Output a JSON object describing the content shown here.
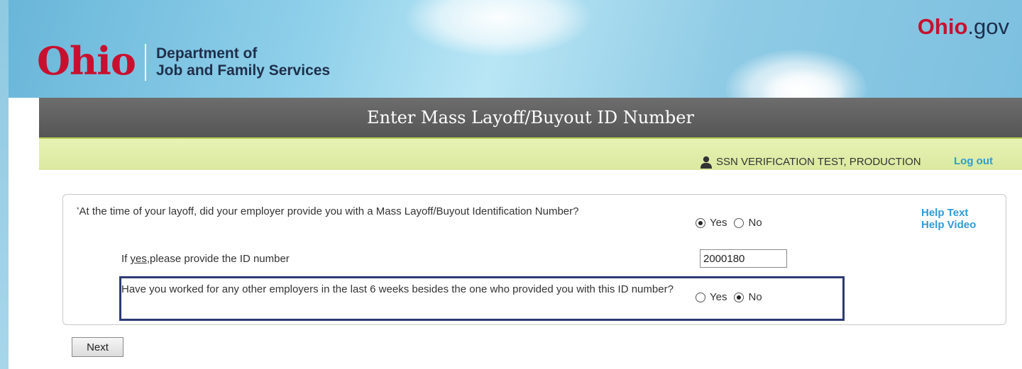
{
  "header": {
    "logo_word": "Ohio",
    "department_line1": "Department of",
    "department_line2": "Job and Family Services",
    "ohio_gov_part1": "Ohio",
    "ohio_gov_part2": ".gov"
  },
  "page_title": "Enter Mass Layoff/Buyout ID Number",
  "user_bar": {
    "user_icon": "user-icon",
    "user_name": "SSN VERIFICATION TEST, PRODUCTION",
    "logout_label": "Log out"
  },
  "form": {
    "q1": {
      "required_mark": "*",
      "text": "At the time of your layoff, did your employer provide you with a Mass Layoff/Buyout Identification Number?",
      "options": [
        "Yes",
        "No"
      ],
      "selected": "Yes"
    },
    "q2": {
      "prefix": "If ",
      "underlined": "yes",
      "suffix": ",please provide the ID number",
      "value": "2000180"
    },
    "q3": {
      "text": "Have you worked for any other employers in the last 6 weeks besides the one who provided you with this ID number?",
      "options": [
        "Yes",
        "No"
      ],
      "selected": "No"
    },
    "help_text_label": "Help Text",
    "help_video_label": "Help Video"
  },
  "next_label": "Next",
  "colors": {
    "ohio_red": "#c8102e",
    "link_blue": "#2f9bd6",
    "highlight_navy": "#2d3b73",
    "title_bar_gray": "#5e5e5e",
    "user_bar_green": "#e2eeab"
  }
}
